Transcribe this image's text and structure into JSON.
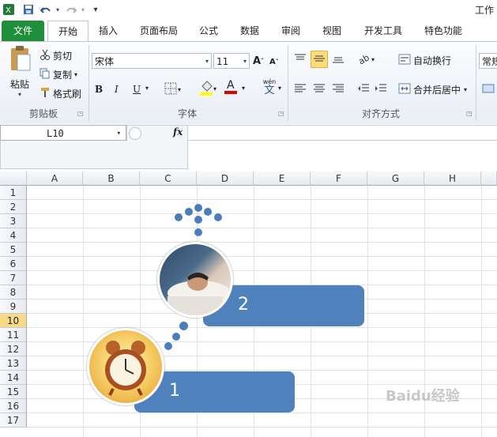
{
  "window": {
    "title": "工作"
  },
  "quick_access": {
    "app_icon": "excel-icon",
    "save_icon": "save-icon",
    "undo_icon": "undo-icon",
    "redo_icon": "redo-icon",
    "customize_icon": "customize-icon"
  },
  "tabs": [
    {
      "label": "文件"
    },
    {
      "label": "开始"
    },
    {
      "label": "插入"
    },
    {
      "label": "页面布局"
    },
    {
      "label": "公式"
    },
    {
      "label": "数据"
    },
    {
      "label": "审阅"
    },
    {
      "label": "视图"
    },
    {
      "label": "开发工具"
    },
    {
      "label": "特色功能"
    }
  ],
  "ribbon": {
    "clipboard": {
      "paste_label": "粘贴",
      "cut_label": "剪切",
      "copy_label": "复制",
      "format_painter_label": "格式刷",
      "group_label": "剪贴板"
    },
    "font": {
      "font_name": "宋体",
      "font_size": "11",
      "bold": "B",
      "italic": "I",
      "underline": "U",
      "grow": "A",
      "shrink": "A",
      "font_color_letter": "A",
      "wen_label": "wén",
      "wen_char": "文",
      "group_label": "字体"
    },
    "alignment": {
      "wrap_label": "自动换行",
      "merge_label": "合并后居中",
      "group_label": "对齐方式"
    },
    "number": {
      "format_value": "常规"
    }
  },
  "formula_bar": {
    "cell_ref": "L10",
    "fx_label": "fx",
    "value": ""
  },
  "sheet": {
    "columns": [
      "A",
      "B",
      "C",
      "D",
      "E",
      "F",
      "G",
      "H"
    ],
    "rows": [
      "1",
      "2",
      "3",
      "4",
      "5",
      "6",
      "7",
      "8",
      "9",
      "10",
      "11",
      "12",
      "13",
      "14",
      "15",
      "16",
      "17"
    ],
    "active_row": "10"
  },
  "graphic": {
    "label_2": "2",
    "label_1": "1",
    "fill_color": "#4f81bd"
  },
  "watermark": {
    "text": "Baidu经验"
  }
}
